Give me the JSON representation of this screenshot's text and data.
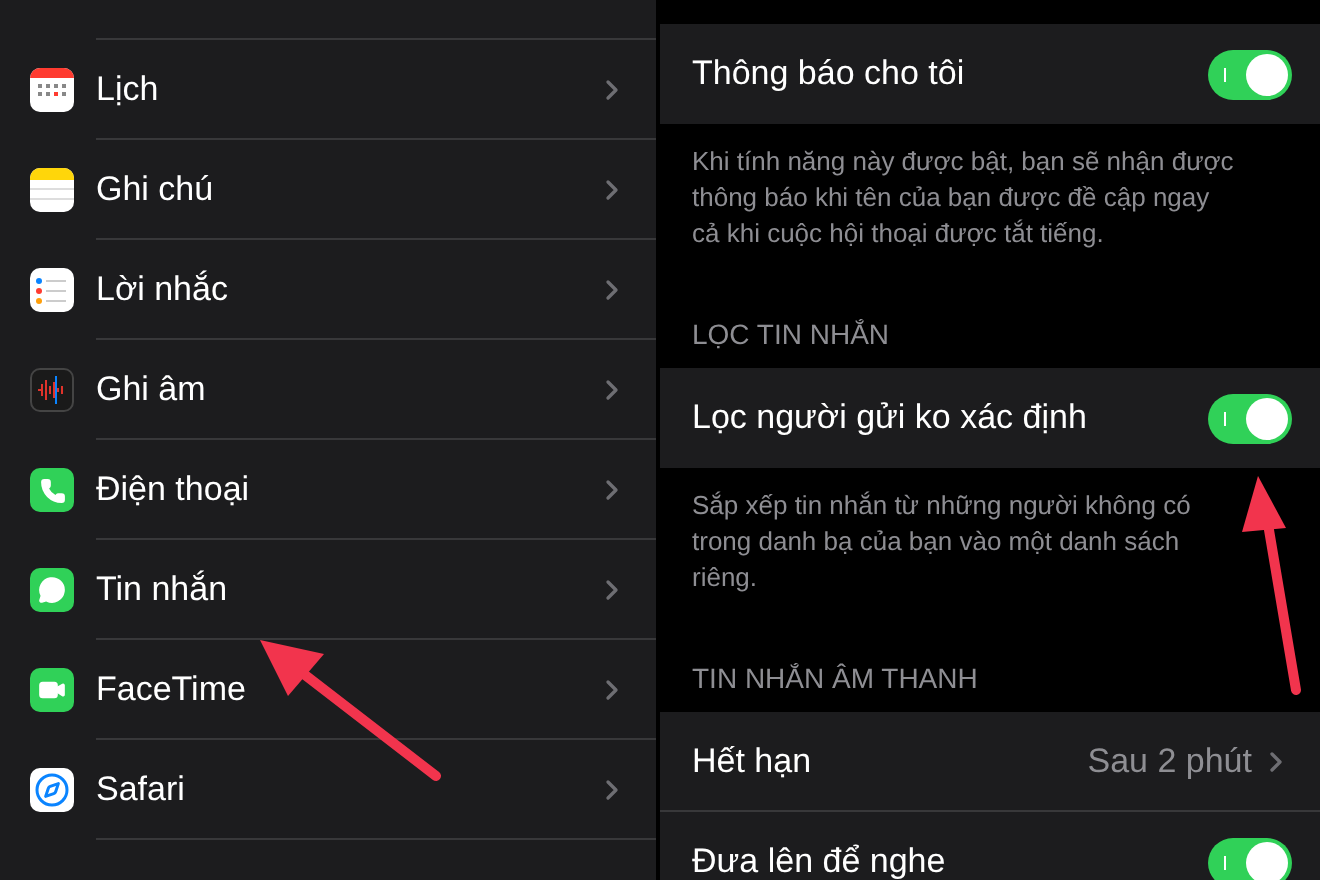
{
  "settings_list": [
    {
      "kind": "calendar",
      "label": "Lịch"
    },
    {
      "kind": "notes",
      "label": "Ghi chú"
    },
    {
      "kind": "reminders",
      "label": "Lời nhắc"
    },
    {
      "kind": "voice",
      "label": "Ghi âm"
    },
    {
      "kind": "phone",
      "label": "Điện thoại"
    },
    {
      "kind": "messages",
      "label": "Tin nhắn"
    },
    {
      "kind": "facetime",
      "label": "FaceTime"
    },
    {
      "kind": "safari",
      "label": "Safari"
    }
  ],
  "messages_settings": [
    {
      "rows": [
        {
          "kind": "toggle",
          "label": "Thông báo cho tôi",
          "on": true
        }
      ],
      "footer": "Khi tính năng này được bật, bạn sẽ nhận được thông báo khi tên của bạn được đề cập ngay cả khi cuộc hội thoại được tắt tiếng."
    },
    {
      "header": "LỌC TIN NHẮN",
      "rows": [
        {
          "kind": "toggle",
          "label": "Lọc người gửi ko xác định",
          "on": true
        }
      ],
      "footer": "Sắp xếp tin nhắn từ những người không có trong danh bạ của bạn vào một danh sách riêng."
    },
    {
      "header": "TIN NHẮN ÂM THANH",
      "rows": [
        {
          "kind": "value",
          "label": "Hết hạn",
          "value": "Sau 2 phút"
        },
        {
          "kind": "toggle",
          "label": "Đưa lên để nghe",
          "on": true
        }
      ]
    }
  ]
}
